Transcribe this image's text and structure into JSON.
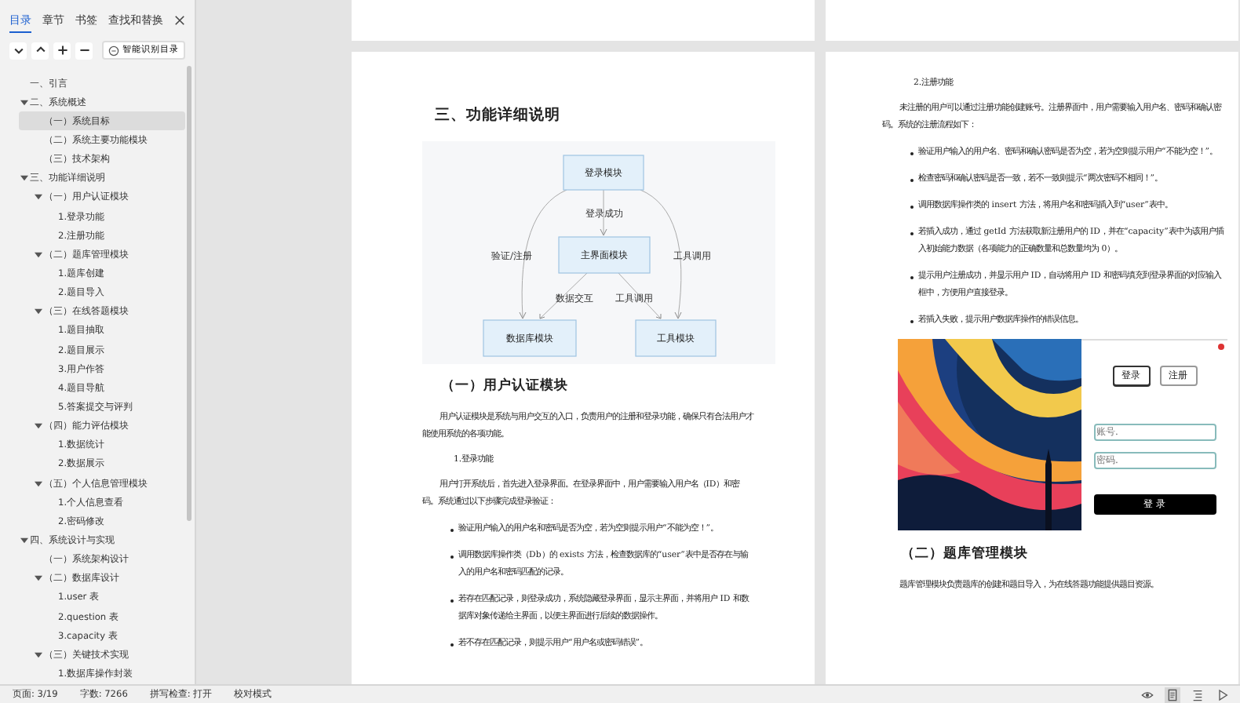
{
  "sidebar": {
    "tabs": [
      {
        "label": "目录",
        "selected": true
      },
      {
        "label": "章节",
        "selected": false
      },
      {
        "label": "书签",
        "selected": false
      },
      {
        "label": "查找和替换",
        "selected": false
      }
    ],
    "tools": [
      {
        "kind": "down"
      },
      {
        "kind": "up"
      },
      {
        "kind": "plus"
      },
      {
        "kind": "minus"
      }
    ],
    "smart_button": "智能识别目录",
    "outline": [
      {
        "label": "一、引言",
        "selected": false
      },
      {
        "label": "二、系统概述",
        "selected": false,
        "expanded": true,
        "children": [
          {
            "label": "（一）系统目标",
            "selected": true
          },
          {
            "label": "（二）系统主要功能模块",
            "selected": false
          },
          {
            "label": "（三）技术架构",
            "selected": false
          }
        ]
      },
      {
        "label": "三、功能详细说明",
        "selected": false,
        "expanded": true,
        "children": [
          {
            "label": "（一）用户认证模块",
            "selected": false,
            "expanded": true,
            "children": [
              {
                "label": "1.登录功能",
                "selected": false
              },
              {
                "label": "2.注册功能",
                "selected": false
              }
            ]
          },
          {
            "label": "（二）题库管理模块",
            "selected": false,
            "expanded": true,
            "children": [
              {
                "label": "1.题库创建",
                "selected": false
              },
              {
                "label": "2.题目导入",
                "selected": false
              }
            ]
          },
          {
            "label": "（三）在线答题模块",
            "selected": false,
            "expanded": true,
            "children": [
              {
                "label": "1.题目抽取",
                "selected": false
              },
              {
                "label": "2.题目展示",
                "selected": false
              },
              {
                "label": "3.用户作答",
                "selected": false
              },
              {
                "label": "4.题目导航",
                "selected": false
              },
              {
                "label": "5.答案提交与评判",
                "selected": false
              }
            ]
          },
          {
            "label": "（四）能力评估模块",
            "selected": false,
            "expanded": true,
            "children": [
              {
                "label": "1.数据统计",
                "selected": false
              },
              {
                "label": "2.数据展示",
                "selected": false
              }
            ]
          },
          {
            "label": "（五）个人信息管理模块",
            "selected": false,
            "expanded": true,
            "children": [
              {
                "label": "1.个人信息查看",
                "selected": false
              },
              {
                "label": "2.密码修改",
                "selected": false
              }
            ]
          }
        ]
      },
      {
        "label": "四、系统设计与实现",
        "selected": false,
        "expanded": true,
        "children": [
          {
            "label": "（一）系统架构设计",
            "selected": false
          },
          {
            "label": "（二）数据库设计",
            "selected": false,
            "expanded": true,
            "children": [
              {
                "label": "1.user 表",
                "selected": false
              },
              {
                "label": "2.question 表",
                "selected": false
              },
              {
                "label": "3.capacity 表",
                "selected": false
              }
            ]
          },
          {
            "label": "（三）关键技术实现",
            "selected": false,
            "expanded": true,
            "children": [
              {
                "label": "1.数据库操作封装",
                "selected": false
              }
            ]
          }
        ]
      }
    ]
  },
  "pages": [
    {
      "blocks": [
        {
          "kind": "h1",
          "text": "三、功能详细说明"
        },
        {
          "kind": "diagram",
          "nodes": [
            "登录模块",
            "主界面模块",
            "数据库模块",
            "工具模块"
          ],
          "edge_labels": [
            "登录成功",
            "验证/注册",
            "工具调用",
            "数据交互",
            "工具调用"
          ]
        },
        {
          "kind": "h2",
          "text": "（一）用户认证模块"
        },
        {
          "kind": "p",
          "text": "用户认证模块是系统与用户交互的入口，负责用户的注册和登录功能，确保只有合法用户才能使用系统的各项功能。"
        },
        {
          "kind": "item",
          "text": "1.登录功能"
        },
        {
          "kind": "p",
          "text": "用户打开系统后，首先进入登录界面。在登录界面中，用户需要输入用户名（ID）和密码。系统通过以下步骤完成登录验证："
        },
        {
          "kind": "bullet",
          "text": "验证用户输入的用户名和密码是否为空，若为空则提示用户“不能为空！”。"
        },
        {
          "kind": "bullet",
          "text": "调用数据库操作类（Db）的 exists 方法，检查数据库的“user”表中是否存在与输入的用户名和密码匹配的记录。"
        },
        {
          "kind": "bullet",
          "text": "若存在匹配记录，则登录成功，系统隐藏登录界面，显示主界面，并将用户 ID 和数据库对象传递给主界面，以便主界面进行后续的数据操作。"
        },
        {
          "kind": "bullet",
          "text": "若不存在匹配记录，则提示用户“用户名或密码错误”。"
        }
      ]
    },
    {
      "blocks": [
        {
          "kind": "item",
          "text": "2.注册功能"
        },
        {
          "kind": "p",
          "text": "未注册的用户可以通过注册功能创建账号。注册界面中，用户需要输入用户名、密码和确认密码。系统的注册流程如下："
        },
        {
          "kind": "bullet",
          "text": "验证用户输入的用户名、密码和确认密码是否为空，若为空则提示用户“不能为空！”。"
        },
        {
          "kind": "bullet",
          "text": "检查密码和确认密码是否一致，若不一致则提示“两次密码不相同！”。"
        },
        {
          "kind": "bullet",
          "text": "调用数据库操作类的 insert 方法，将用户名和密码插入到“user”表中。"
        },
        {
          "kind": "bullet",
          "text": "若插入成功，通过 getId 方法获取新注册用户的 ID，并在“capacity”表中为该用户插入初始能力数据（各项能力的正确数量和总数量均为 0）。"
        },
        {
          "kind": "bullet",
          "text": "提示用户注册成功，并显示用户 ID，自动将用户 ID 和密码填充到登录界面的对应输入框中，方便用户直接登录。"
        },
        {
          "kind": "bullet",
          "text": "若插入失败，提示用户数据库操作的错误信息。"
        },
        {
          "kind": "figure",
          "tabs": [
            {
              "label": "登录",
              "selected": true
            },
            {
              "label": "注册",
              "selected": false
            }
          ],
          "fields": [
            {
              "placeholder": "账号."
            },
            {
              "placeholder": "密码."
            }
          ],
          "submit": "登 录"
        },
        {
          "kind": "h2",
          "text": "（二）题库管理模块"
        },
        {
          "kind": "p",
          "text": "题库管理模块负责题库的创建和题目导入，为在线答题功能提供题目资源。"
        }
      ]
    }
  ],
  "status_bar": {
    "items": [
      "页面: 3/19",
      "字数: 7266",
      "拼写检查: 打开",
      "校对模式"
    ],
    "views": [
      {
        "kind": "eye",
        "selected": false
      },
      {
        "kind": "page",
        "selected": true
      },
      {
        "kind": "outline",
        "selected": false
      },
      {
        "kind": "play",
        "selected": false
      }
    ]
  }
}
